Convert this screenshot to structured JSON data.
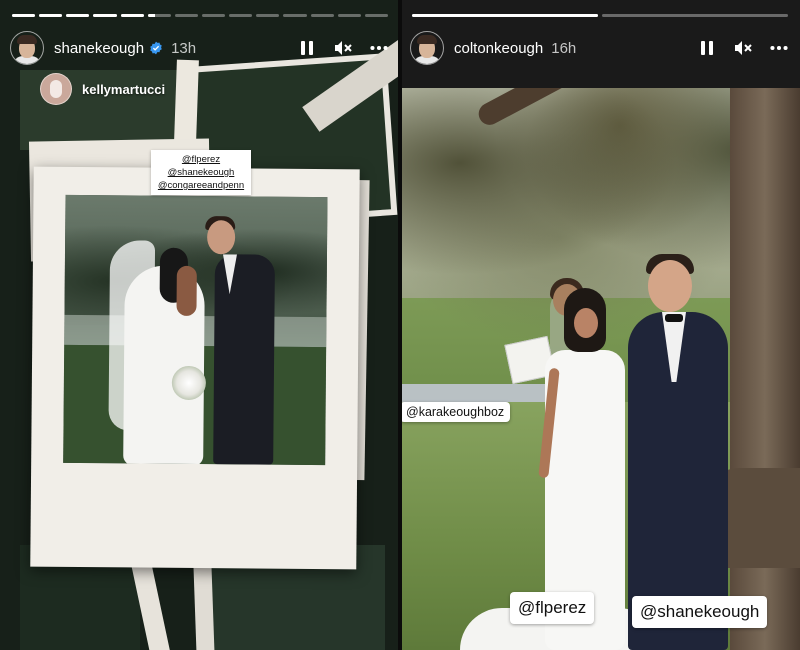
{
  "left_story": {
    "username": "shanekeough",
    "verified": true,
    "time": "13h",
    "progress": {
      "segments": 14,
      "completed": 5,
      "current_fraction": 0.3
    },
    "repost": {
      "username": "kellymartucci"
    },
    "tags": [
      "@flperez",
      "@shanekeough",
      "@congareeandpenn"
    ]
  },
  "right_story": {
    "username": "coltonkeough",
    "verified": false,
    "time": "16h",
    "progress": {
      "segments": 2,
      "completed": 1,
      "current_fraction": 0.0
    },
    "stickers": {
      "small": "@karakeoughboz",
      "bottom_left": "@flperez",
      "bottom_right": "@shanekeough"
    }
  },
  "icons": {
    "pause": "pause-icon",
    "mute": "muted-speaker-icon",
    "more": "more-horizontal-icon",
    "verified": "verified-badge-icon"
  },
  "colors": {
    "verified_blue": "#3897f0",
    "progress_active": "#ffffff",
    "progress_inactive": "rgba(255,255,255,0.35)"
  }
}
